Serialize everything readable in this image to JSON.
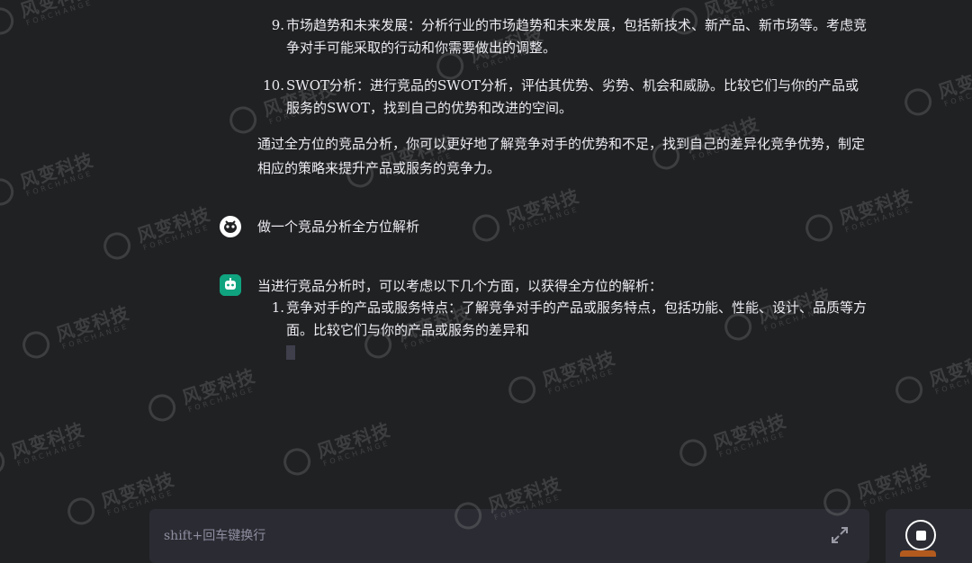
{
  "messages": {
    "list_items_prev": [
      {
        "num": "9.",
        "text": "市场趋势和未来发展：分析行业的市场趋势和未来发展，包括新技术、新产品、新市场等。考虑竞争对手可能采取的行动和你需要做出的调整。"
      },
      {
        "num": "10.",
        "text": "SWOT分析：进行竞品的SWOT分析，评估其优势、劣势、机会和威胁。比较它们与你的产品或服务的SWOT，找到自己的优势和改进的空间。"
      }
    ],
    "summary": "通过全方位的竞品分析，你可以更好地了解竞争对手的优势和不足，找到自己的差异化竞争优势，制定相应的策略来提升产品或服务的竞争力。",
    "user_prompt": "做一个竞品分析全方位解析",
    "bot_intro": "当进行竞品分析时，可以考虑以下几个方面，以获得全方位的解析：",
    "bot_items": [
      {
        "num": "1.",
        "text": "竞争对手的产品或服务特点：了解竞争对手的产品或服务特点，包括功能、性能、设计、品质等方面。比较它们与你的产品或服务的差异和"
      }
    ]
  },
  "composer": {
    "placeholder": "shift+回车键换行"
  },
  "watermark": {
    "cn": "风变科技",
    "en": "FORCHANGE"
  },
  "colors": {
    "background": "#202123",
    "bot_avatar": "#10a37f",
    "composer_bg": "#2b2c33",
    "accent": "#b35a1f"
  },
  "icons": {
    "user_avatar": "user-avatar-icon",
    "bot_avatar": "bot-avatar-icon",
    "expand": "expand-icon",
    "stop": "stop-icon"
  }
}
